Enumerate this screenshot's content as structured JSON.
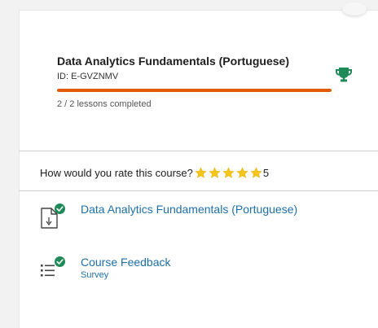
{
  "course": {
    "title": "Data Analytics Fundamentals (Portuguese)",
    "id": "ID: E-GVZNMV",
    "progress_fraction": 1.0,
    "lessons_completed": "2 / 2 lessons completed",
    "progress_color": "#e05b00",
    "trophy_color": "#1e8a57"
  },
  "rating": {
    "question": "How would you rate this course?",
    "stars": 5,
    "value": "5",
    "star_color": "#f5c518"
  },
  "items": [
    {
      "title": "Data Analytics Fundamentals (Portuguese)",
      "subtitle": "",
      "icon": "document-icon",
      "completed": true
    },
    {
      "title": "Course Feedback",
      "subtitle": "Survey",
      "icon": "checklist-icon",
      "completed": true
    }
  ],
  "colors": {
    "link": "#1d6fa8",
    "check": "#1e8a57"
  }
}
